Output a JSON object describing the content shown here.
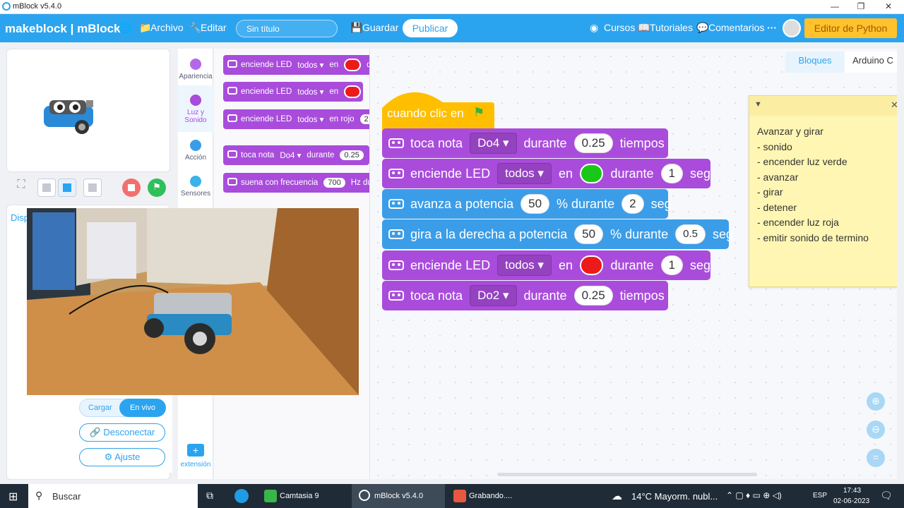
{
  "window": {
    "title": "mBlock v5.4.0",
    "minimize": "—",
    "maximize": "❐",
    "close": "✕"
  },
  "menu": {
    "brand": "makeblock | mBlock",
    "archivo": "Archivo",
    "editar": "Editar",
    "project_name": "Sin título",
    "guardar": "Guardar",
    "publicar": "Publicar",
    "cursos": "Cursos",
    "tutoriales": "Tutoriales",
    "comentarios": "Comentarios",
    "more": "···",
    "python": "Editor de Python"
  },
  "categories": [
    {
      "label": "Apariencia",
      "color": "#b468e6"
    },
    {
      "label": "Luz y Sonido",
      "color": "#a94cdb"
    },
    {
      "label": "Acción",
      "color": "#3b9de8"
    },
    {
      "label": "Sensores",
      "color": "#3bb2e8"
    }
  ],
  "extension_label": "extensión",
  "palette": {
    "b1": {
      "a": "enciende LED",
      "b": "todos ▾",
      "c": "en",
      "d": "du"
    },
    "b2": {
      "a": "enciende LED",
      "b": "todos ▾",
      "c": "en"
    },
    "b3": {
      "a": "enciende LED",
      "b": "todos ▾",
      "c": "en rojo",
      "d": "2"
    },
    "b4": {
      "a": "toca nota",
      "b": "Do4 ▾",
      "c": "durante",
      "d": "0.25"
    },
    "b5": {
      "a": "suena con frecuencia",
      "b": "700",
      "c": "Hz dura"
    }
  },
  "left_panel": {
    "tab": "Disp",
    "cargar": "Cargar",
    "en_vivo": "En vivo",
    "desconectar": "Desconectar",
    "ajuste": "Ajuste"
  },
  "tabs": {
    "bloques": "Bloques",
    "arduino": "Arduino C"
  },
  "script": {
    "hat": "cuando clic en",
    "b1": {
      "a": "toca nota",
      "note": "Do4",
      "b": "durante",
      "v": "0.25",
      "c": "tiempos"
    },
    "b2": {
      "a": "enciende LED",
      "dd": "todos",
      "b": "en",
      "color": "#19c719",
      "c": "durante",
      "v": "1",
      "d": "seg"
    },
    "b3": {
      "a": "avanza a potencia",
      "v": "50",
      "b": "% durante",
      "v2": "2",
      "c": "seg"
    },
    "b4": {
      "a": "gira a la derecha a potencia",
      "v": "50",
      "b": "% durante",
      "v2": "0.5",
      "c": "seg"
    },
    "b5": {
      "a": "enciende LED",
      "dd": "todos",
      "b": "en",
      "color": "#ee1a1a",
      "c": "durante",
      "v": "1",
      "d": "seg"
    },
    "b6": {
      "a": "toca nota",
      "note": "Do2",
      "b": "durante",
      "v": "0.25",
      "c": "tiempos"
    }
  },
  "note": {
    "lines": [
      "Avanzar y girar",
      "- sonido",
      "- encender luz verde",
      "- avanzar",
      "- girar",
      "- detener",
      "- encender luz roja",
      "- emitir sonido de termino"
    ]
  },
  "taskbar": {
    "search": "Buscar",
    "camtasia": "Camtasia 9",
    "mblock": "mBlock v5.4.0",
    "grabando": "Grabando....",
    "weather": "14°C  Mayorm. nubl...",
    "lang": "ESP",
    "time": "17:43",
    "date": "02-06-2023"
  }
}
